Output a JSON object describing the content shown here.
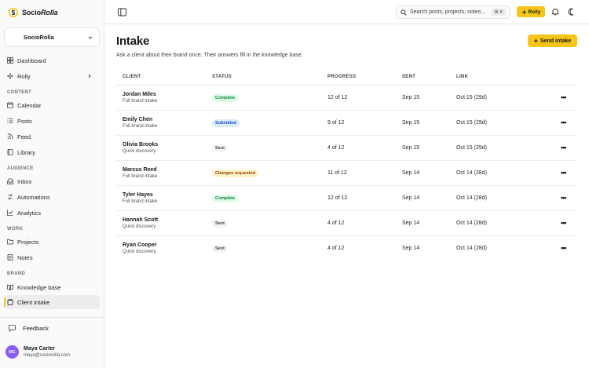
{
  "brand": {
    "name_a": "Socio",
    "name_b": "Rolla",
    "accent": "#f5c518"
  },
  "workspace": {
    "name": "SocioRolla"
  },
  "sidebar": {
    "items": [
      {
        "label": "Dashboard",
        "icon": "grid-icon"
      },
      {
        "label": "Rolly",
        "icon": "sparkle-icon"
      }
    ],
    "sections": [
      {
        "title": "CONTENT",
        "items": [
          {
            "label": "Calendar",
            "icon": "calendar-icon"
          },
          {
            "label": "Posts",
            "icon": "list-icon"
          },
          {
            "label": "Feed",
            "icon": "rss-icon"
          },
          {
            "label": "Library",
            "icon": "book-icon"
          }
        ]
      },
      {
        "title": "AUDIENCE",
        "items": [
          {
            "label": "Inbox",
            "icon": "inbox-icon"
          },
          {
            "label": "Automations",
            "icon": "automation-icon"
          },
          {
            "label": "Analytics",
            "icon": "chart-icon"
          }
        ]
      },
      {
        "title": "WORK",
        "items": [
          {
            "label": "Projects",
            "icon": "folder-icon"
          },
          {
            "label": "Notes",
            "icon": "note-icon"
          }
        ]
      },
      {
        "title": "BRAND",
        "items": [
          {
            "label": "Knowledge base",
            "icon": "knowledge-icon"
          },
          {
            "label": "Client intake",
            "icon": "clipboard-icon",
            "active": true
          }
        ]
      }
    ],
    "feedback_label": "Feedback",
    "user": {
      "initials": "MC",
      "name": "Maya Carter",
      "email": "maya@sociorolla.com"
    }
  },
  "topbar": {
    "search_placeholder": "Search posts, projects, notes...",
    "search_shortcut": "⌘ K",
    "rolly_label": "Rolly"
  },
  "page": {
    "title": "Intake",
    "subtitle": "Ask a client about their brand once. Their answers fill in the knowledge base.",
    "send_label": "Send intake"
  },
  "table": {
    "columns": [
      "CLIENT",
      "STATUS",
      "PROGRESS",
      "SENT",
      "LINK"
    ],
    "rows": [
      {
        "name": "Jordan Miles",
        "type": "Full brand intake",
        "status": "Complete",
        "status_kind": "complete",
        "progress": "12 of 12",
        "sent": "Sep 15",
        "link": "Oct 15 (29d)"
      },
      {
        "name": "Emily Chen",
        "type": "Full brand intake",
        "status": "Submitted",
        "status_kind": "submitted",
        "progress": "9 of 12",
        "sent": "Sep 15",
        "link": "Oct 15 (29d)"
      },
      {
        "name": "Olivia Brooks",
        "type": "Quick discovery",
        "status": "Sent",
        "status_kind": "sent",
        "progress": "4 of 12",
        "sent": "Sep 15",
        "link": "Oct 15 (29d)"
      },
      {
        "name": "Marcus Reed",
        "type": "Full brand intake",
        "status": "Changes requested",
        "status_kind": "changes",
        "progress": "11 of 12",
        "sent": "Sep 14",
        "link": "Oct 14 (28d)"
      },
      {
        "name": "Tyler Hayes",
        "type": "Full brand intake",
        "status": "Complete",
        "status_kind": "complete",
        "progress": "12 of 12",
        "sent": "Sep 14",
        "link": "Oct 14 (28d)"
      },
      {
        "name": "Hannah Scott",
        "type": "Quick discovery",
        "status": "Sent",
        "status_kind": "sent",
        "progress": "4 of 12",
        "sent": "Sep 14",
        "link": "Oct 14 (28d)"
      },
      {
        "name": "Ryan Cooper",
        "type": "Quick discovery",
        "status": "Sent",
        "status_kind": "sent",
        "progress": "4 of 12",
        "sent": "Sep 14",
        "link": "Oct 14 (28d)"
      }
    ]
  }
}
